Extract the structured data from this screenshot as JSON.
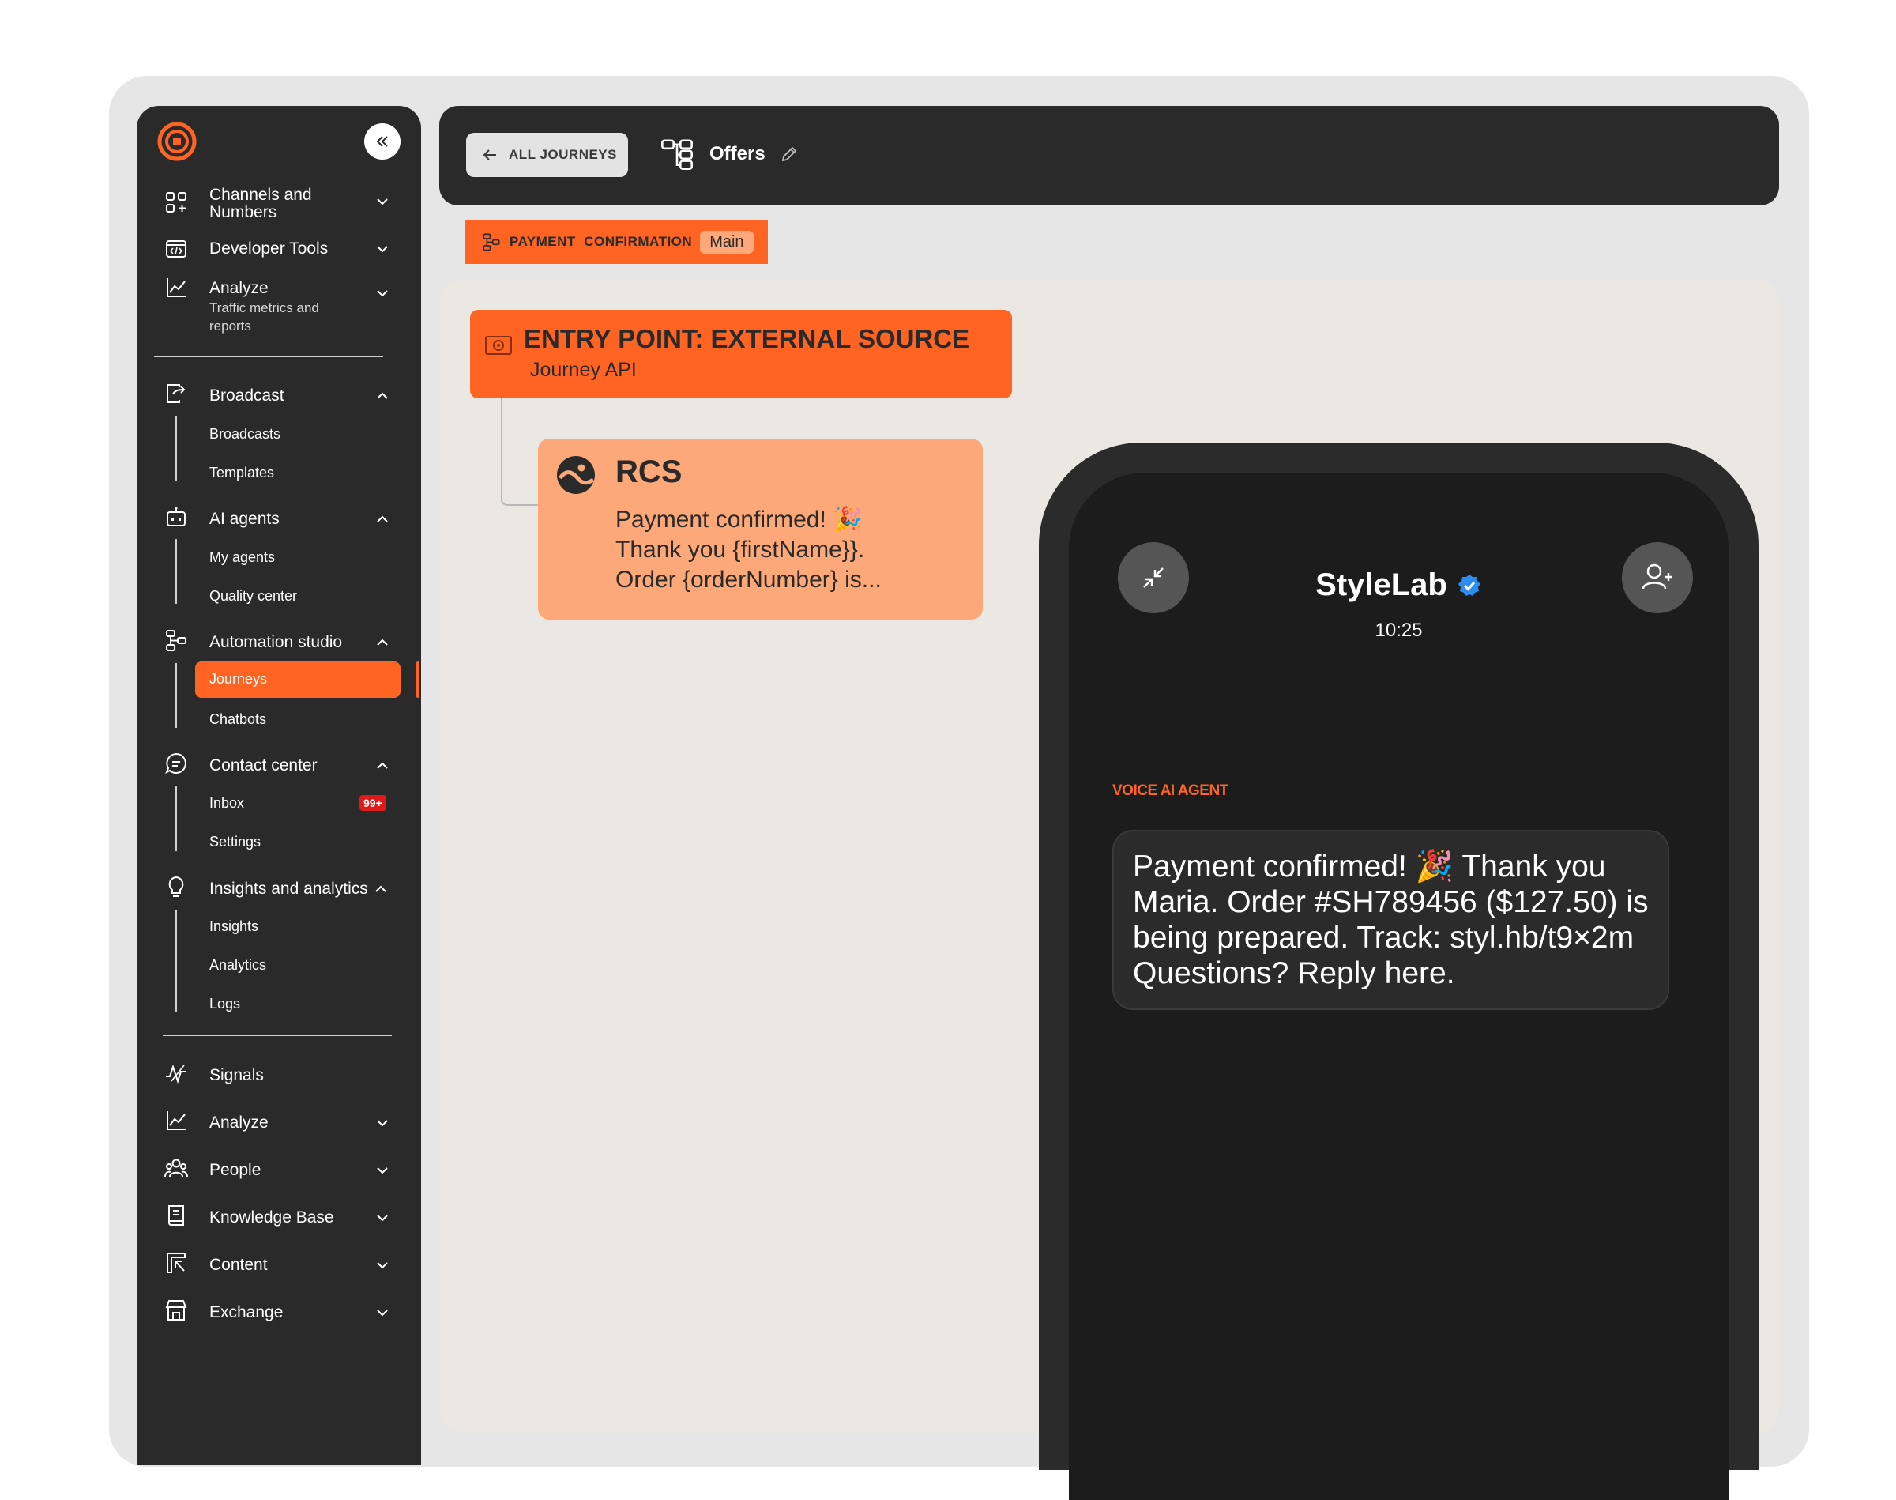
{
  "sidebar": {
    "collapse_icon": "double-chevron-left-icon",
    "groups": [
      {
        "label": "Channels and Numbers",
        "icon": "grid-plus-icon"
      },
      {
        "label": "Developer Tools",
        "icon": "code-window-icon"
      },
      {
        "label": "Analyze",
        "sub": "Traffic metrics and reports",
        "icon": "chart-line-icon"
      }
    ],
    "broadcast": {
      "label": "Broadcast",
      "items": [
        "Broadcasts",
        "Templates"
      ]
    },
    "ai_agents": {
      "label": "AI agents",
      "items": [
        "My agents",
        "Quality center"
      ]
    },
    "automation": {
      "label": "Automation studio",
      "items": [
        "Journeys",
        "Chatbots"
      ],
      "active": "Journeys"
    },
    "contact_center": {
      "label": "Contact center",
      "items": [
        "Inbox",
        "Settings"
      ],
      "inbox_badge": "99+"
    },
    "insights": {
      "label": "Insights and analytics",
      "items": [
        "Insights",
        "Analytics",
        "Logs"
      ]
    },
    "bottom": [
      {
        "label": "Signals",
        "icon": "signal-wave-icon"
      },
      {
        "label": "Analyze",
        "icon": "chart-line-icon"
      },
      {
        "label": "People",
        "icon": "people-icon"
      },
      {
        "label": "Knowledge Base",
        "icon": "book-icon"
      },
      {
        "label": "Content",
        "icon": "content-icon"
      },
      {
        "label": "Exchange",
        "icon": "store-icon"
      }
    ]
  },
  "topbar": {
    "back_label": "ALL JOURNEYS",
    "journey_name": "Offers"
  },
  "tag": {
    "label": "PAYMENT  CONFIRMATION",
    "badge": "Main"
  },
  "canvas": {
    "entry": {
      "title": "ENTRY POINT: EXTERNAL SOURCE",
      "subtitle": "Journey API"
    },
    "rcs": {
      "title": "RCS",
      "line1": "Payment confirmed! 🎉",
      "line2": "Thank you {firstName}}.",
      "line3": "Order {orderNumber} is..."
    }
  },
  "phone": {
    "brand": "StyleLab",
    "time": "10:25",
    "agent_label": "VOICE AI AGENT",
    "message": "Payment confirmed! 🎉 Thank you Maria. Order #SH789456 ($127.50) is being prepared. Track: styl.hb/t9×2m Questions? Reply here."
  },
  "colors": {
    "accent": "#ff6422",
    "dark": "#2a2a2a",
    "canvas": "#ebe8e3",
    "verified": "#2d8cf0"
  }
}
